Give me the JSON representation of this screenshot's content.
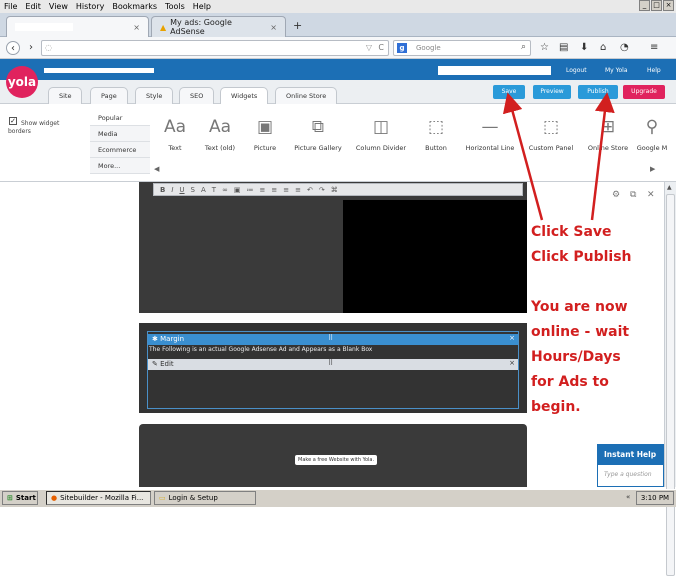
{
  "browser": {
    "menus": [
      "File",
      "Edit",
      "View",
      "History",
      "Bookmarks",
      "Tools",
      "Help"
    ],
    "tabs": [
      {
        "label": ""
      },
      {
        "label": "My ads: Google AdSense"
      }
    ],
    "new_tab": "+",
    "url_value": "",
    "search_engine": "Google",
    "search_placeholder": "Google"
  },
  "yola": {
    "logo": "yola",
    "header_links": [
      "Logout",
      "My Yola",
      "Help"
    ],
    "nav_tabs": [
      "Site",
      "Page",
      "Style",
      "SEO",
      "Widgets",
      "Online Store"
    ],
    "actions": {
      "save": "Save",
      "preview": "Preview",
      "publish": "Publish",
      "upgrade": "Upgrade"
    },
    "show_borders_label": "Show widget borders",
    "categories": [
      "Popular",
      "Media",
      "Ecommerce",
      "More..."
    ],
    "widgets": [
      "Text",
      "Text (old)",
      "Picture",
      "Picture Gallery",
      "Column Divider",
      "Button",
      "Horizontal Line",
      "Custom Panel",
      "Online Store",
      "Google M"
    ]
  },
  "content": {
    "margin_title": "Margin",
    "margin_text": "The Following is an actual Google Adsense Ad and Appears as a Blank Box",
    "edit_label": "Edit",
    "free_site": "Make a free Website with Yola."
  },
  "help": {
    "title": "Instant Help",
    "placeholder": "Type a question"
  },
  "annotation": {
    "line1": "Click Save",
    "line2": "Click Publish",
    "line3": "You are now",
    "line4": "online - wait",
    "line5": "Hours/Days",
    "line6": "for Ads to",
    "line7": "begin."
  },
  "taskbar": {
    "start": "Start",
    "items": [
      "Sitebuilder - Mozilla Fi...",
      "Login & Setup"
    ],
    "time": "3:10 PM"
  },
  "colors": {
    "yola_blue": "#1c6fb5",
    "save_blue": "#2a9ad9",
    "upgrade_pink": "#e0235e",
    "annotation_red": "#d21f1f"
  }
}
